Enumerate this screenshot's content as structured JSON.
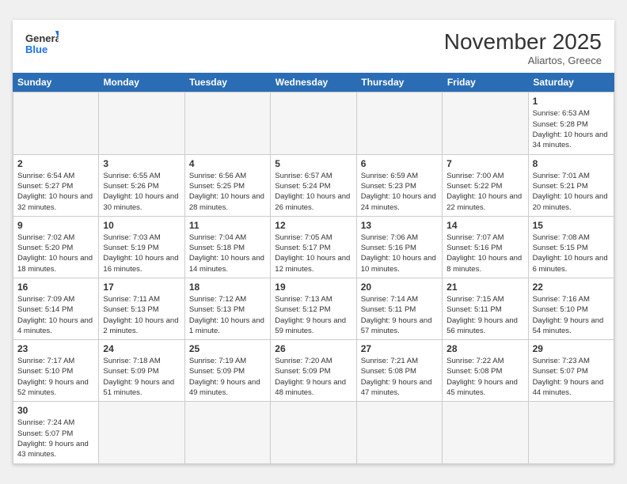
{
  "header": {
    "logo_general": "General",
    "logo_blue": "Blue",
    "month": "November 2025",
    "location": "Aliartos, Greece"
  },
  "days": [
    "Sunday",
    "Monday",
    "Tuesday",
    "Wednesday",
    "Thursday",
    "Friday",
    "Saturday"
  ],
  "cells": [
    {
      "date": "",
      "empty": true
    },
    {
      "date": "",
      "empty": true
    },
    {
      "date": "",
      "empty": true
    },
    {
      "date": "",
      "empty": true
    },
    {
      "date": "",
      "empty": true
    },
    {
      "date": "",
      "empty": true
    },
    {
      "date": "1",
      "sunrise": "Sunrise: 6:53 AM",
      "sunset": "Sunset: 5:28 PM",
      "daylight": "Daylight: 10 hours and 34 minutes."
    },
    {
      "date": "2",
      "sunrise": "Sunrise: 6:54 AM",
      "sunset": "Sunset: 5:27 PM",
      "daylight": "Daylight: 10 hours and 32 minutes."
    },
    {
      "date": "3",
      "sunrise": "Sunrise: 6:55 AM",
      "sunset": "Sunset: 5:26 PM",
      "daylight": "Daylight: 10 hours and 30 minutes."
    },
    {
      "date": "4",
      "sunrise": "Sunrise: 6:56 AM",
      "sunset": "Sunset: 5:25 PM",
      "daylight": "Daylight: 10 hours and 28 minutes."
    },
    {
      "date": "5",
      "sunrise": "Sunrise: 6:57 AM",
      "sunset": "Sunset: 5:24 PM",
      "daylight": "Daylight: 10 hours and 26 minutes."
    },
    {
      "date": "6",
      "sunrise": "Sunrise: 6:59 AM",
      "sunset": "Sunset: 5:23 PM",
      "daylight": "Daylight: 10 hours and 24 minutes."
    },
    {
      "date": "7",
      "sunrise": "Sunrise: 7:00 AM",
      "sunset": "Sunset: 5:22 PM",
      "daylight": "Daylight: 10 hours and 22 minutes."
    },
    {
      "date": "8",
      "sunrise": "Sunrise: 7:01 AM",
      "sunset": "Sunset: 5:21 PM",
      "daylight": "Daylight: 10 hours and 20 minutes."
    },
    {
      "date": "9",
      "sunrise": "Sunrise: 7:02 AM",
      "sunset": "Sunset: 5:20 PM",
      "daylight": "Daylight: 10 hours and 18 minutes."
    },
    {
      "date": "10",
      "sunrise": "Sunrise: 7:03 AM",
      "sunset": "Sunset: 5:19 PM",
      "daylight": "Daylight: 10 hours and 16 minutes."
    },
    {
      "date": "11",
      "sunrise": "Sunrise: 7:04 AM",
      "sunset": "Sunset: 5:18 PM",
      "daylight": "Daylight: 10 hours and 14 minutes."
    },
    {
      "date": "12",
      "sunrise": "Sunrise: 7:05 AM",
      "sunset": "Sunset: 5:17 PM",
      "daylight": "Daylight: 10 hours and 12 minutes."
    },
    {
      "date": "13",
      "sunrise": "Sunrise: 7:06 AM",
      "sunset": "Sunset: 5:16 PM",
      "daylight": "Daylight: 10 hours and 10 minutes."
    },
    {
      "date": "14",
      "sunrise": "Sunrise: 7:07 AM",
      "sunset": "Sunset: 5:16 PM",
      "daylight": "Daylight: 10 hours and 8 minutes."
    },
    {
      "date": "15",
      "sunrise": "Sunrise: 7:08 AM",
      "sunset": "Sunset: 5:15 PM",
      "daylight": "Daylight: 10 hours and 6 minutes."
    },
    {
      "date": "16",
      "sunrise": "Sunrise: 7:09 AM",
      "sunset": "Sunset: 5:14 PM",
      "daylight": "Daylight: 10 hours and 4 minutes."
    },
    {
      "date": "17",
      "sunrise": "Sunrise: 7:11 AM",
      "sunset": "Sunset: 5:13 PM",
      "daylight": "Daylight: 10 hours and 2 minutes."
    },
    {
      "date": "18",
      "sunrise": "Sunrise: 7:12 AM",
      "sunset": "Sunset: 5:13 PM",
      "daylight": "Daylight: 10 hours and 1 minute."
    },
    {
      "date": "19",
      "sunrise": "Sunrise: 7:13 AM",
      "sunset": "Sunset: 5:12 PM",
      "daylight": "Daylight: 9 hours and 59 minutes."
    },
    {
      "date": "20",
      "sunrise": "Sunrise: 7:14 AM",
      "sunset": "Sunset: 5:11 PM",
      "daylight": "Daylight: 9 hours and 57 minutes."
    },
    {
      "date": "21",
      "sunrise": "Sunrise: 7:15 AM",
      "sunset": "Sunset: 5:11 PM",
      "daylight": "Daylight: 9 hours and 56 minutes."
    },
    {
      "date": "22",
      "sunrise": "Sunrise: 7:16 AM",
      "sunset": "Sunset: 5:10 PM",
      "daylight": "Daylight: 9 hours and 54 minutes."
    },
    {
      "date": "23",
      "sunrise": "Sunrise: 7:17 AM",
      "sunset": "Sunset: 5:10 PM",
      "daylight": "Daylight: 9 hours and 52 minutes."
    },
    {
      "date": "24",
      "sunrise": "Sunrise: 7:18 AM",
      "sunset": "Sunset: 5:09 PM",
      "daylight": "Daylight: 9 hours and 51 minutes."
    },
    {
      "date": "25",
      "sunrise": "Sunrise: 7:19 AM",
      "sunset": "Sunset: 5:09 PM",
      "daylight": "Daylight: 9 hours and 49 minutes."
    },
    {
      "date": "26",
      "sunrise": "Sunrise: 7:20 AM",
      "sunset": "Sunset: 5:09 PM",
      "daylight": "Daylight: 9 hours and 48 minutes."
    },
    {
      "date": "27",
      "sunrise": "Sunrise: 7:21 AM",
      "sunset": "Sunset: 5:08 PM",
      "daylight": "Daylight: 9 hours and 47 minutes."
    },
    {
      "date": "28",
      "sunrise": "Sunrise: 7:22 AM",
      "sunset": "Sunset: 5:08 PM",
      "daylight": "Daylight: 9 hours and 45 minutes."
    },
    {
      "date": "29",
      "sunrise": "Sunrise: 7:23 AM",
      "sunset": "Sunset: 5:07 PM",
      "daylight": "Daylight: 9 hours and 44 minutes."
    },
    {
      "date": "30",
      "sunrise": "Sunrise: 7:24 AM",
      "sunset": "Sunset: 5:07 PM",
      "daylight": "Daylight: 9 hours and 43 minutes."
    },
    {
      "date": "",
      "empty": true
    },
    {
      "date": "",
      "empty": true
    },
    {
      "date": "",
      "empty": true
    },
    {
      "date": "",
      "empty": true
    },
    {
      "date": "",
      "empty": true
    },
    {
      "date": "",
      "empty": true
    }
  ]
}
